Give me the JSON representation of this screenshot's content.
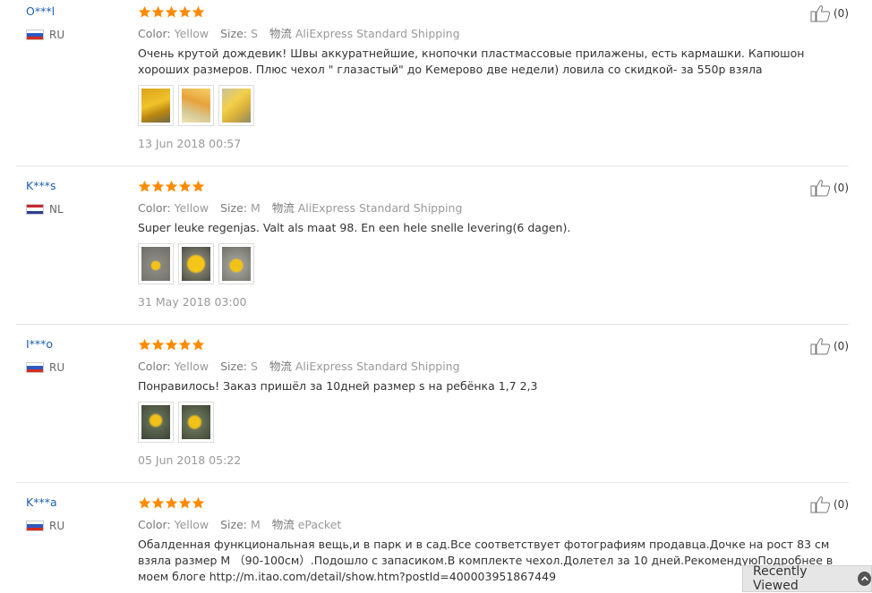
{
  "colors": {
    "star": "#ff8a00",
    "link": "#1d5fb0",
    "meta": "#999999"
  },
  "labels": {
    "color": "Color:",
    "size": "Size:",
    "logistics": "物流",
    "recently_viewed": "Recently Viewed"
  },
  "reviews": [
    {
      "user": "O***l",
      "country": "RU",
      "stars": 5,
      "color": "Yellow",
      "size": "S",
      "shipping": "AliExpress Standard Shipping",
      "text": "Очень крутой дождевик! Швы аккуратнейшие, кнопочки пластмассовые прилажены, есть кармашки. Капюшон хороших размеров. Плюс чехол \" глазастый\" до Кемерово две недели) ловила со скидкой- за 550р взяла",
      "images": [
        "photo-1",
        "photo-2",
        "photo-3"
      ],
      "date": "13 Jun 2018 00:57",
      "helpful": "(0)"
    },
    {
      "user": "K***s",
      "country": "NL",
      "stars": 5,
      "color": "Yellow",
      "size": "M",
      "shipping": "AliExpress Standard Shipping",
      "text": "Super leuke regenjas. Valt als maat 98. En een hele snelle levering(6 dagen).",
      "images": [
        "photo-1",
        "photo-2",
        "photo-3"
      ],
      "date": "31 May 2018 03:00",
      "helpful": "(0)"
    },
    {
      "user": "I***o",
      "country": "RU",
      "stars": 5,
      "color": "Yellow",
      "size": "S",
      "shipping": "AliExpress Standard Shipping",
      "text": "Понравилось! Заказ пришёл за 10дней размер s на ребёнка 1,7 2,3",
      "images": [
        "photo-1",
        "photo-2"
      ],
      "date": "05 Jun 2018 05:22",
      "helpful": "(0)"
    },
    {
      "user": "K***a",
      "country": "RU",
      "stars": 5,
      "color": "Yellow",
      "size": "M",
      "shipping": "ePacket",
      "text": "Обалденная функциональная вещь,и в парк и в сад.Все соответствует фотографиям продавца.Дочке на рост 83 см взяла размер M （90-100см）.Подошло с запасиком.В комплекте чехол.Долетел за 10 дней.РекомендуюПодробнее в моем блоге http://m.itao.com/detail/show.htm?postId=400003951867449",
      "images": [],
      "date": "",
      "helpful": "(0)"
    }
  ]
}
